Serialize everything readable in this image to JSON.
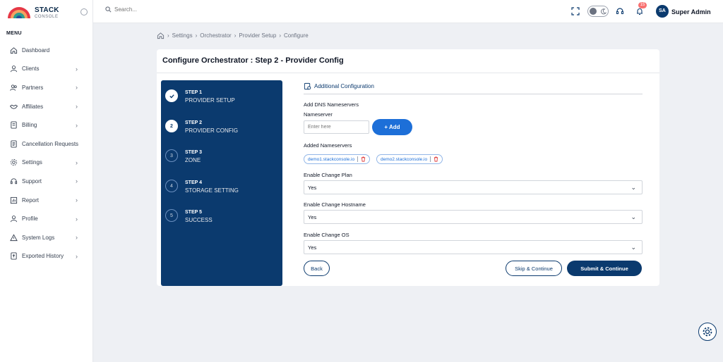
{
  "brand": {
    "name": "STACK",
    "sub": "CONSOLE"
  },
  "sidebar": {
    "menu_title": "MENU",
    "items": [
      {
        "label": "Dashboard",
        "icon": "home-icon"
      },
      {
        "label": "Clients",
        "icon": "user-icon"
      },
      {
        "label": "Partners",
        "icon": "users-icon"
      },
      {
        "label": "Affiliates",
        "icon": "handshake-icon"
      },
      {
        "label": "Billing",
        "icon": "billing-icon"
      },
      {
        "label": "Cancellation Requests",
        "icon": "document-icon"
      },
      {
        "label": "Settings",
        "icon": "gear-icon"
      },
      {
        "label": "Support",
        "icon": "headset-icon"
      },
      {
        "label": "Report",
        "icon": "report-icon"
      },
      {
        "label": "Profile",
        "icon": "profile-icon"
      },
      {
        "label": "System Logs",
        "icon": "warning-icon"
      },
      {
        "label": "Exported History",
        "icon": "export-icon"
      }
    ]
  },
  "header": {
    "search_placeholder": "Search...",
    "notification_count": "15",
    "user_initials": "SA",
    "user_name": "Super Admin"
  },
  "breadcrumb": [
    "Settings",
    "Orchestrator",
    "Provider Setup",
    "Configure"
  ],
  "page": {
    "title": "Configure Orchestrator : Step 2 - Provider Config"
  },
  "steps": [
    {
      "num": "STEP 1",
      "name": "PROVIDER SETUP",
      "badge": "",
      "state": "done"
    },
    {
      "num": "STEP 2",
      "name": "PROVIDER CONFIG",
      "badge": "2",
      "state": "active"
    },
    {
      "num": "STEP 3",
      "name": "ZONE",
      "badge": "3",
      "state": "pending"
    },
    {
      "num": "STEP 4",
      "name": "STORAGE SETTING",
      "badge": "4",
      "state": "pending"
    },
    {
      "num": "STEP 5",
      "name": "SUCCESS",
      "badge": "5",
      "state": "pending"
    }
  ],
  "form": {
    "section_title": "Additional Configuration",
    "dns_label": "Add DNS Nameservers",
    "nameserver_label": "Nameserver",
    "nameserver_placeholder": "Enter here",
    "add_button": "+ Add",
    "added_label": "Added Nameservers",
    "nameservers": [
      "demo1.stackconsole.io",
      "demo2.stackconsole.io"
    ],
    "change_plan_label": "Enable Change Plan",
    "change_plan_value": "Yes",
    "change_hostname_label": "Enable Change Hostname",
    "change_hostname_value": "Yes",
    "change_os_label": "Enable Change OS",
    "change_os_value": "Yes",
    "back_button": "Back",
    "skip_button": "Skip & Continue",
    "submit_button": "Submit & Continue"
  },
  "colors": {
    "primary": "#0b3a6e",
    "accent": "#1d6fd8",
    "danger": "#dc2626"
  }
}
